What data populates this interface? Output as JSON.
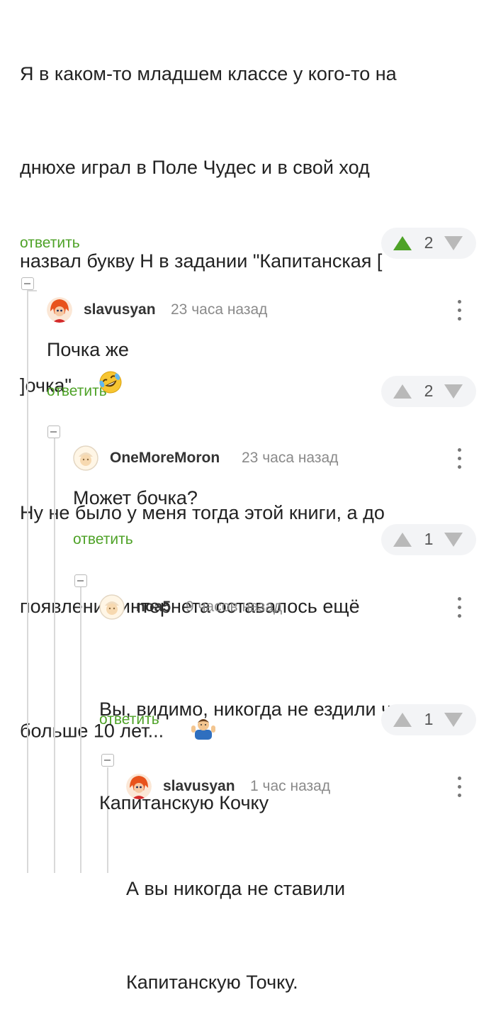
{
  "colors": {
    "accent": "#4ea227",
    "thread_line": "#d9d9d9",
    "rating_bg": "#f3f4f6"
  },
  "top_comment": {
    "lines": [
      "Я в каком-то младшем классе у кого-то на",
      "днюхе играл в Поле Чудес и в свой ход",
      "назвал букву Н в задании \"Капитанская [",
      "]очка\"",
      "Ну не было у меня тогда этой книги, а до",
      "появления интернета оставалось ещё",
      "больше 10 лет..."
    ],
    "emoji_1": "rolling-on-floor-laughing-emoji",
    "emoji_2": "person-shrugging-emoji",
    "reply_label": "ответить",
    "rating": "2",
    "upvoted": true
  },
  "comments": [
    {
      "username": "slavusyan",
      "time": "23 часа назад",
      "avatar": "red-haired-cartoon-avatar",
      "lines": [
        "Почка же"
      ],
      "reply_label": "ответить",
      "rating": "2"
    },
    {
      "username": "OneMoreMoron",
      "time": "23 часа назад",
      "avatar": "default-placeholder-avatar",
      "lines": [
        "Может бочка?"
      ],
      "reply_label": "ответить",
      "rating": "1"
    },
    {
      "username": "noa5",
      "time": "9 часов назад",
      "avatar": "default-placeholder-avatar",
      "lines": [
        "Вы, видимо, никогда не ездили через",
        "Капитанскую Кочку"
      ],
      "reply_label": "ответить",
      "rating": "1"
    },
    {
      "username": "slavusyan",
      "time": "1 час назад",
      "avatar": "red-haired-cartoon-avatar",
      "lines": [
        "А вы никогда не ставили",
        "Капитанскую Точку."
      ]
    }
  ]
}
